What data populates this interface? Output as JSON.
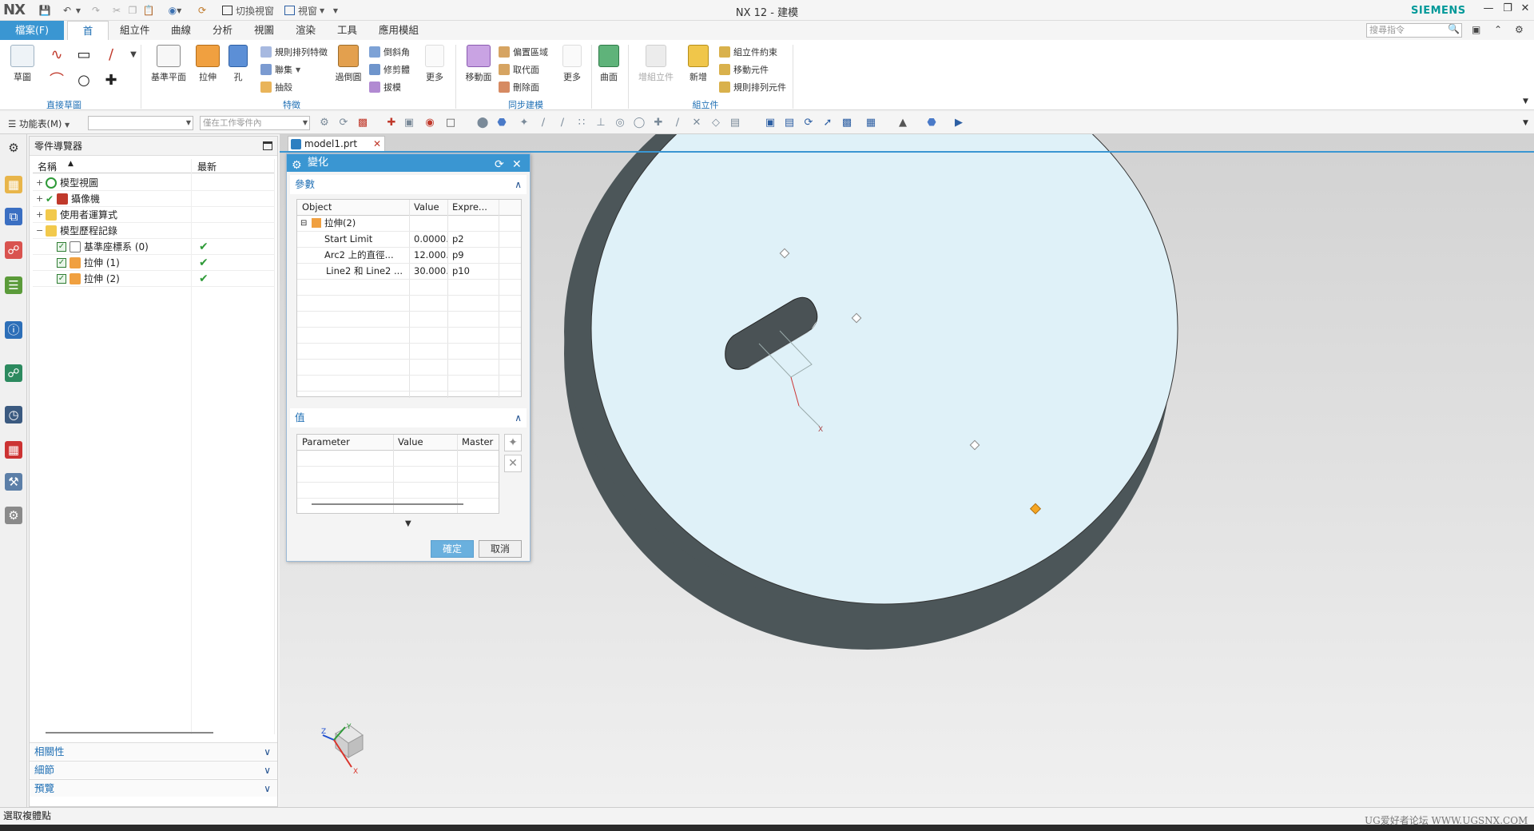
{
  "app": {
    "logo": "NX",
    "window_title": "NX 12 - 建模",
    "brand": "SIEMENS",
    "switch_window_label": "切換視窗",
    "window_menu_label": "視窗"
  },
  "tabs": [
    {
      "label": "檔案(F)"
    },
    {
      "label": "首頁"
    },
    {
      "label": "組立件"
    },
    {
      "label": "曲線"
    },
    {
      "label": "分析"
    },
    {
      "label": "視圖"
    },
    {
      "label": "渲染"
    },
    {
      "label": "工具"
    },
    {
      "label": "應用模組"
    }
  ],
  "search_commands": {
    "placeholder": "搜尋指令"
  },
  "ribbon": {
    "sketch": "草圖",
    "direct_sketch_group": "直接草圖",
    "datum_plane": "基準平面",
    "extrude": "拉伸",
    "hole": "孔",
    "pattern_feature": "規則排列特徵",
    "unite": "聯集",
    "shell": "抽殼",
    "edge_blend": "倒斜角",
    "trim_body": "修剪體",
    "draft": "拔模",
    "chamfer_blend": "過倒圓",
    "more_feature": "更多",
    "feature_group": "特徵",
    "move_face": "移動面",
    "offset_region": "偏置區域",
    "replace_face": "取代面",
    "delete_face": "刪除面",
    "more_sync": "更多",
    "sync_group": "同步建模",
    "surface": "曲面",
    "add_component_disabled": "增組立件",
    "new_component": "新增",
    "assembly_constraint": "組立件約束",
    "move_component": "移動元件",
    "pattern_component": "規則排列元件",
    "assembly_group": "組立件"
  },
  "toolbar2": {
    "menu_label": "功能表(M)",
    "filter_placeholder": "",
    "scope_placeholder": "僅在工作零件內"
  },
  "part_navigator": {
    "title": "零件導覽器",
    "col_name": "名稱",
    "col_latest": "最新",
    "rows": [
      {
        "label": "模型視圖",
        "indent": 0
      },
      {
        "label": "攝像機",
        "indent": 0
      },
      {
        "label": "使用者運算式",
        "indent": 0
      },
      {
        "label": "模型歷程記錄",
        "indent": 0
      },
      {
        "label": "基準座標系 (0)",
        "indent": 1
      },
      {
        "label": "拉伸 (1)",
        "indent": 1
      },
      {
        "label": "拉伸 (2)",
        "indent": 1
      }
    ],
    "latest_mark": "✔",
    "sections": [
      "相關性",
      "細節",
      "預覽"
    ]
  },
  "document": {
    "tab_label": "model1.prt"
  },
  "dialog": {
    "title": "變化",
    "section_params": "參數",
    "param_headers": [
      "Object",
      "Value",
      "Expre..."
    ],
    "param_rows": [
      {
        "object": "拉伸(2)",
        "value": "",
        "expr": ""
      },
      {
        "object": "Start Limit",
        "value": "0.0000...",
        "expr": "p2"
      },
      {
        "object": "Arc2 上的直徑...",
        "value": "12.000...",
        "expr": "p9"
      },
      {
        "object": "Line2 和 Line2 ...",
        "value": "30.000...",
        "expr": "p10"
      }
    ],
    "section_values": "值",
    "value_headers": [
      "Parameter",
      "Value",
      "Master I"
    ],
    "ok": "確定",
    "cancel": "取消"
  },
  "status": {
    "text": "選取複體點"
  },
  "watermark": "UG爱好者论坛 WWW.UGSNX.COM",
  "colors": {
    "accent": "#3a96d2",
    "disk_face": "#dff1f8",
    "disk_side": "#4a5559",
    "check_green": "#2e9a38"
  }
}
